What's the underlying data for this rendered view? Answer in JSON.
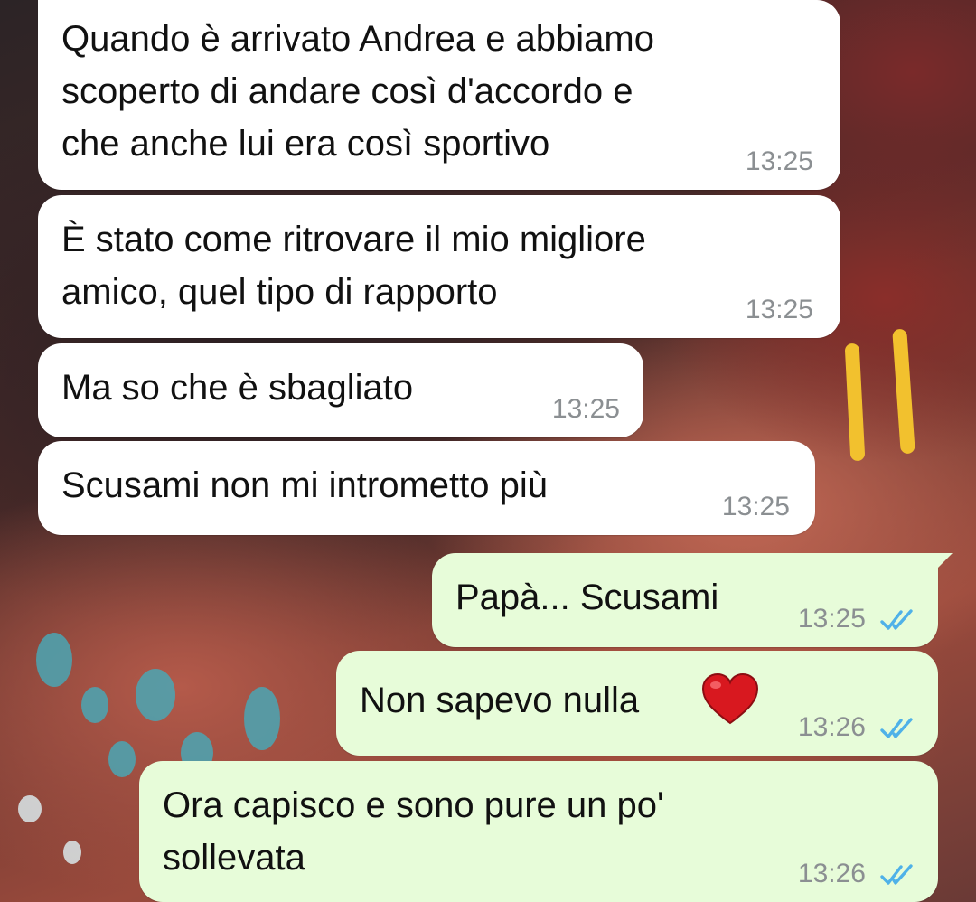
{
  "colors": {
    "incoming_bubble": "#ffffff",
    "outgoing_bubble": "#e7fcd9",
    "timestamp": "#8b8f92",
    "read_ticks": "#4fb1e8"
  },
  "messages": [
    {
      "direction": "in",
      "lines": [
        "Quando è arrivato Andrea e abbiamo",
        "scoperto di andare così d'accordo e",
        "che anche lui era così sportivo"
      ],
      "time": "13:25"
    },
    {
      "direction": "in",
      "lines": [
        "È stato come ritrovare il mio migliore",
        "amico, quel tipo di rapporto"
      ],
      "time": "13:25"
    },
    {
      "direction": "in",
      "lines": [
        "Ma so che è sbagliato"
      ],
      "time": "13:25"
    },
    {
      "direction": "in",
      "lines": [
        "Scusami non mi intrometto più"
      ],
      "time": "13:25"
    },
    {
      "direction": "out",
      "lines": [
        "Papà... Scusami"
      ],
      "time": "13:25",
      "status": "read"
    },
    {
      "direction": "out",
      "lines": [
        "Non sapevo nulla"
      ],
      "emoji": "red-heart-emoji",
      "time": "13:26",
      "status": "read"
    },
    {
      "direction": "out",
      "lines": [
        "Ora capisco e sono pure un po'",
        "sollevata"
      ],
      "time": "13:26",
      "status": "read"
    }
  ]
}
